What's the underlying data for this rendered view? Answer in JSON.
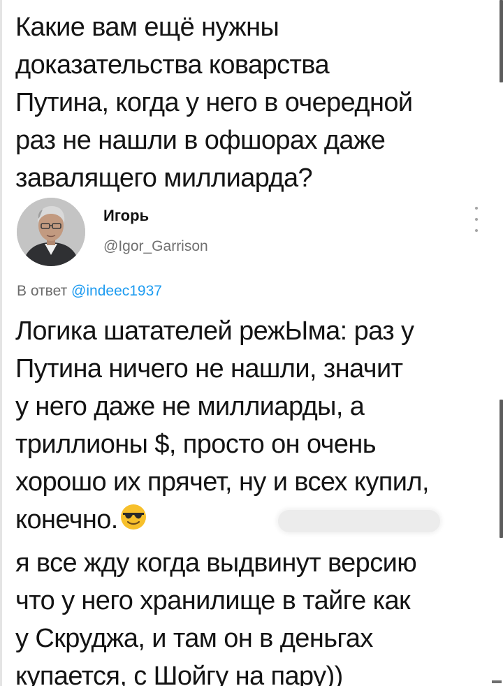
{
  "post": {
    "lines": [
      "Какие вам ещё нужны",
      "доказательства коварства",
      "Путина, когда у него в очередной",
      "раз не нашли в офшорах даже",
      "завалящего миллиарда?"
    ]
  },
  "reply": {
    "author": {
      "name": "Игорь",
      "handle": "@Igor_Garrison",
      "avatar_icon": "user-avatar-photo"
    },
    "more_icon": "vertical-ellipsis-icon",
    "in_reply_to": {
      "prefix": "В ответ",
      "handle": "@indeec1937"
    },
    "lines": [
      "Логика шатателей режЫма: раз у",
      "Путина ничего не нашли, значит",
      "у него даже не миллиарды, а",
      "триллионы $, просто он очень",
      "хорошо их прячет, ну и всех купил,",
      "конечно."
    ],
    "emoji": "smiling-face-with-sunglasses"
  },
  "comment": {
    "lines": [
      "я все жду когда выдвинут версию",
      "что у него хранилище в тайге как",
      "у Скруджа, и там он в деньгах",
      "купается, с Шойгу на пару))"
    ]
  },
  "colors": {
    "text": "#141414",
    "link": "#1d9bf0",
    "muted": "#707070",
    "emoji_face": "#f7c02b",
    "scrollbar": "#5c5c5c"
  }
}
